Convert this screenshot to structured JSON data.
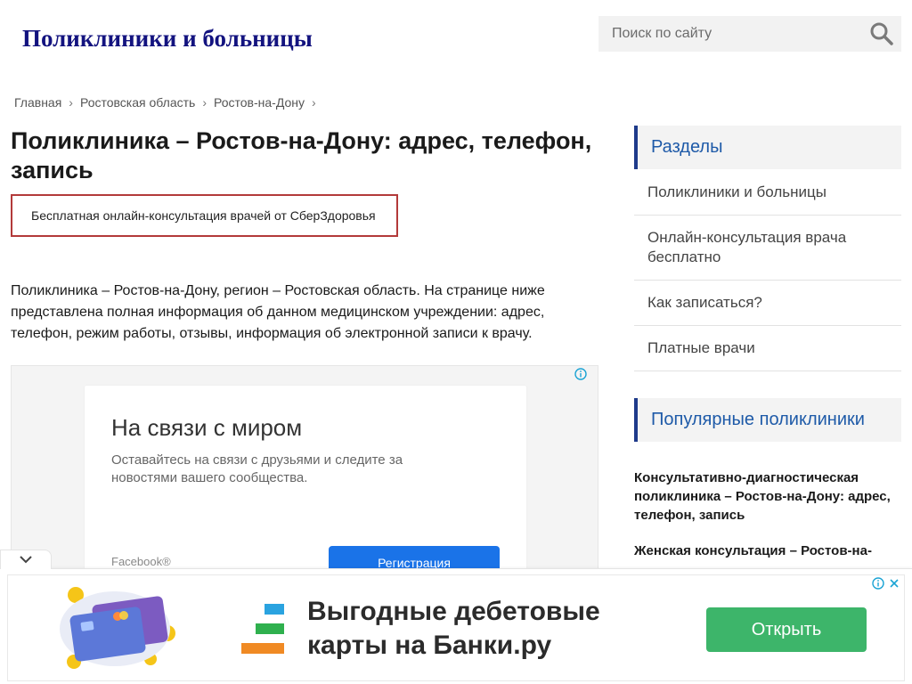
{
  "header": {
    "site_title": "Поликлиники и больницы",
    "search_placeholder": "Поиск по сайту"
  },
  "breadcrumb": [
    {
      "label": "Главная"
    },
    {
      "label": "Ростовская область"
    },
    {
      "label": "Ростов-на-Дону"
    }
  ],
  "breadcrumb_separator": "›",
  "article": {
    "title": "Поликлиника – Ростов-на-Дону: адрес, телефон, запись",
    "consult_banner": "Бесплатная онлайн-консультация врачей от СберЗдоровья",
    "intro": "Поликлиника – Ростов-на-Дону, регион – Ростовская область. На странице ниже представлена полная информация об данном медицинском учреждении: адрес, телефон, режим работы, отзывы, информация об электронной записи к врачу."
  },
  "ad_top": {
    "headline": "На связи с миром",
    "description": "Оставайтесь на связи с друзьями и следите за новостями вашего сообщества.",
    "brand": "Facebook®",
    "cta": "Регистрация"
  },
  "sidebar": {
    "sections_heading": "Разделы",
    "sections": [
      {
        "label": "Поликлиники и больницы"
      },
      {
        "label": "Онлайн-консультация врача бесплатно"
      },
      {
        "label": "Как записаться?"
      },
      {
        "label": "Платные врачи"
      }
    ],
    "popular_heading": "Популярные поликлиники",
    "popular": [
      {
        "label": "Консультативно-диагностическая поликлиника – Ростов-на-Дону: адрес, телефон, запись"
      },
      {
        "label": "Женская консультация – Ростов-на-"
      }
    ]
  },
  "bottom_ad": {
    "headline": "Выгодные дебетовые карты на Банки.ру",
    "cta": "Открыть"
  },
  "colors": {
    "site_title": "#13137f",
    "sidebar_accent": "#1e3a8a",
    "consult_border": "#b33a3a",
    "ad_cta": "#1a73e8",
    "open_button": "#3db56a"
  },
  "icons": {
    "search": "search-icon",
    "collapse": "chevron-down-icon",
    "adchoices": "info-icon",
    "close": "close-icon"
  }
}
